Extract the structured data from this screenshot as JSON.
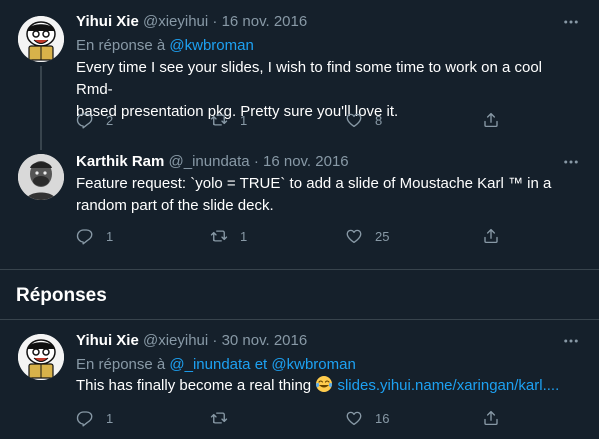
{
  "tweets": [
    {
      "name": "Yihui Xie",
      "handle": "@xieyihui",
      "date": "16 nov. 2016",
      "reply_prefix": "En réponse à",
      "reply_handles": [
        "@kwbroman"
      ],
      "text_line1": "Every time I see your slides, I wish to find some time to work on a cool Rmd-",
      "text_line2": "based presentation pkg. Pretty sure you'll love it.",
      "replies": "2",
      "retweets": "1",
      "likes": "8"
    },
    {
      "name": "Karthik Ram",
      "handle": "@_inundata",
      "date": "16 nov. 2016",
      "text_line1": "Feature request: `yolo = TRUE` to add a slide of Moustache Karl ™ in a",
      "text_line2": "random part of the slide deck.",
      "replies": "1",
      "retweets": "1",
      "likes": "25"
    },
    {
      "name": "Yihui Xie",
      "handle": "@xieyihui",
      "date": "30 nov. 2016",
      "reply_prefix": "En réponse à",
      "reply_handles": [
        "@_inundata",
        "et",
        "@kwbroman"
      ],
      "text": "This has finally become a real thing",
      "link": "slides.yihui.name/xaringan/karl....",
      "replies": "1",
      "retweets": "",
      "likes": "16"
    }
  ],
  "section_title": "Réponses",
  "separator_dot": "·",
  "icons": [
    "more-icon",
    "reply-icon",
    "retweet-icon",
    "like-icon",
    "share-icon",
    "tears-of-joy-emoji"
  ],
  "colors": {
    "background": "#15202b",
    "link": "#1da1f2",
    "muted": "#8899a6",
    "divider": "#38444d"
  }
}
